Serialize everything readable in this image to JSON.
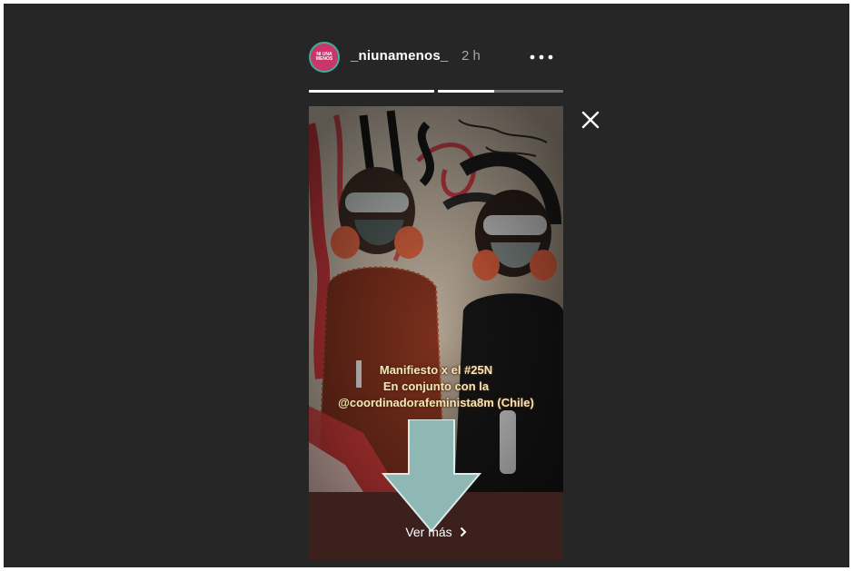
{
  "story": {
    "username": "_niunamenos_",
    "timestamp": "2 h",
    "avatar_text": "NI UNA MENOS",
    "progress": [
      1.0,
      0.45
    ],
    "caption_lines": [
      "Manifiesto x el #25N",
      "En conjunto con la",
      "@coordinadorafeminista8m  (Chile)"
    ],
    "see_more_label": "Ver más",
    "icons": {
      "more": "more-horizontal-icon",
      "close": "close-icon",
      "chevron": "chevron-right-icon"
    }
  },
  "colors": {
    "background": "#262626",
    "avatar_ring": "#3fae9a",
    "avatar_fill": "#c9376a",
    "caption_text": "#f4e6b8",
    "arrow": "#8fb8b5",
    "see_more_bg": "#3b201c"
  }
}
